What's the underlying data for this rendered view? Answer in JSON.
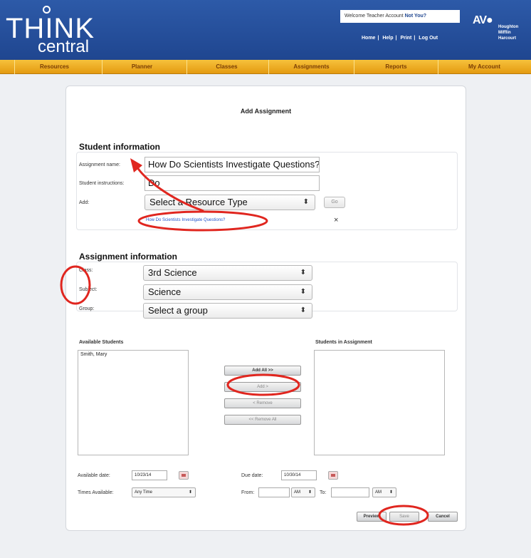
{
  "header": {
    "logo_think": "THINK",
    "logo_central": "central",
    "welcome_text": "Welcome Teacher Account",
    "not_you": "Not You?",
    "links": [
      "Home",
      "Help",
      "Print",
      "Log Out"
    ],
    "brand_mark": "AV●",
    "brand_text": "Houghton Mifflin Harcourt",
    "colors": {
      "header": "#2d5aa8",
      "nav": "#f0b028",
      "annotation": "#e0261f"
    }
  },
  "nav": [
    "Resources",
    "Planner",
    "Classes",
    "Assignments",
    "Reports",
    "My Account"
  ],
  "page": {
    "title": "Add Assignment"
  },
  "student_info": {
    "heading": "Student information",
    "assignment_name_label": "Assignment name:",
    "assignment_name_value": "How Do Scientists Investigate Questions?",
    "instructions_label": "Student instructions:",
    "instructions_value": "Do",
    "add_label": "Add:",
    "resource_type": "Select a Resource Type",
    "go_button": "Go",
    "resource_link": "How Do Scientists Investigate Questions?",
    "remove_x": "×"
  },
  "assignment_info": {
    "heading": "Assignment information",
    "class_label": "Class:",
    "class_value": "3rd Science",
    "subject_label": "Subject:",
    "subject_value": "Science",
    "group_label": "Group:",
    "group_value": "Select a group",
    "available_students_label": "Available Students",
    "available_students": [
      "Smith, Mary"
    ],
    "students_in_assignment_label": "Students in Assignment",
    "buttons": {
      "add_all": "Add All >>",
      "add": "Add >",
      "remove": "< Remove",
      "remove_all": "<< Remove All"
    },
    "available_date_label": "Available date:",
    "available_date": "10/23/14",
    "due_date_label": "Due date:",
    "due_date": "10/30/14",
    "times_available_label": "Times Available:",
    "times_available": "Any Time",
    "from_label": "From:",
    "to_label": "To:",
    "am1": "AM",
    "am2": "AM"
  },
  "actions": {
    "preview": "Preview",
    "save": "Save",
    "cancel": "Cancel"
  }
}
